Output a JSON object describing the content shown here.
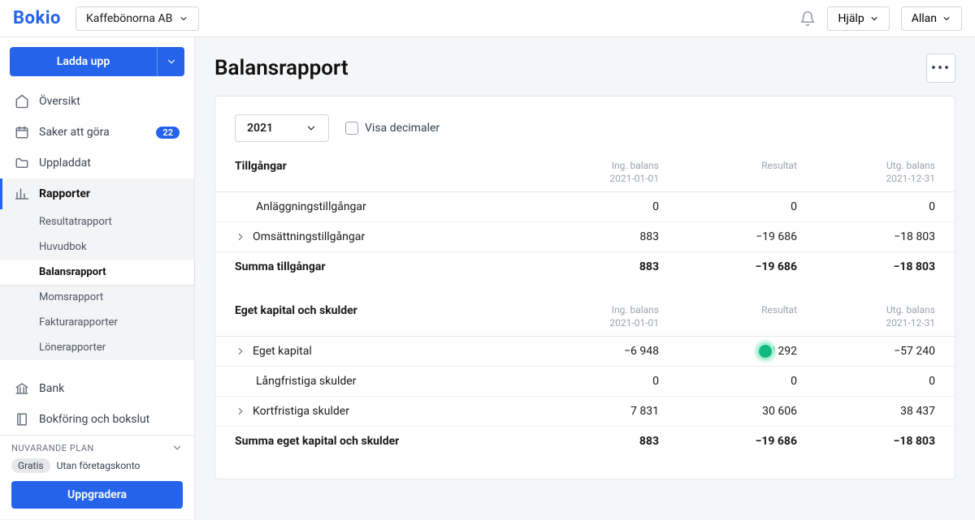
{
  "header": {
    "logo": "Bokio",
    "company": "Kaffebönorna AB",
    "help": "Hjälp",
    "user": "Allan"
  },
  "sidebar": {
    "upload": "Ladda upp",
    "items": {
      "overview": "Översikt",
      "todo": "Saker att göra",
      "todo_count": "22",
      "uploaded": "Uppladdat",
      "reports": "Rapporter",
      "bank": "Bank",
      "bookkeeping": "Bokföring och bokslut"
    },
    "sub": {
      "result": "Resultatrapport",
      "ledger": "Huvudbok",
      "balance": "Balansrapport",
      "vat": "Momsrapport",
      "invoice": "Fakturarapporter",
      "salary": "Lönerapporter"
    },
    "plan": {
      "heading": "NUVARANDE PLAN",
      "free": "Gratis",
      "note": "Utan företagskonto",
      "upgrade": "Uppgradera"
    }
  },
  "page": {
    "title": "Balansrapport",
    "year": "2021",
    "decimals": "Visa decimaler"
  },
  "cols": {
    "opening": "Ing. balans",
    "opening_date": "2021-01-01",
    "result": "Resultat",
    "closing": "Utg. balans",
    "closing_date": "2021-12-31"
  },
  "sections": {
    "assets": {
      "title": "Tillgångar",
      "rows": {
        "fixed": {
          "label": "Anläggningstillgångar",
          "open": "0",
          "result": "0",
          "close": "0"
        },
        "current": {
          "label": "Omsättningstillgångar",
          "open": "883",
          "result": "−19 686",
          "close": "−18 803"
        }
      },
      "sum": {
        "label": "Summa tillgångar",
        "open": "883",
        "result": "−19 686",
        "close": "−18 803"
      }
    },
    "liab": {
      "title": "Eget kapital och skulder",
      "rows": {
        "equity": {
          "label": "Eget kapital",
          "open": "−6 948",
          "result": "−50 292",
          "close": "−57 240"
        },
        "long": {
          "label": "Långfristiga skulder",
          "open": "0",
          "result": "0",
          "close": "0"
        },
        "short": {
          "label": "Kortfristiga skulder",
          "open": "7 831",
          "result": "30 606",
          "close": "38 437"
        }
      },
      "sum": {
        "label": "Summa eget kapital och skulder",
        "open": "883",
        "result": "−19 686",
        "close": "−18 803"
      }
    }
  }
}
